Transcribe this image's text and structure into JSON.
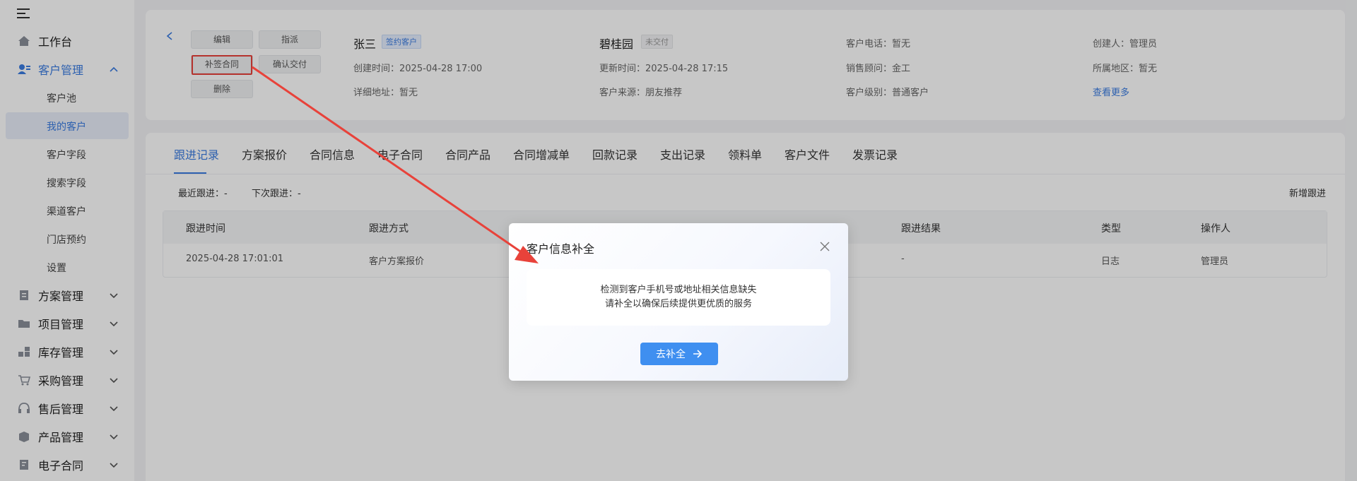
{
  "sidebar": {
    "workbench": "工作台",
    "customer_mgmt": "客户管理",
    "sub": [
      "客户池",
      "我的客户",
      "客户字段",
      "搜索字段",
      "渠道客户",
      "门店预约",
      "设置"
    ],
    "groups": [
      "方案管理",
      "项目管理",
      "库存管理",
      "采购管理",
      "售后管理",
      "产品管理",
      "电子合同"
    ]
  },
  "actions": {
    "edit": "编辑",
    "assign": "指派",
    "supplement_contract": "补签合同",
    "confirm_delivery": "确认交付",
    "delete": "删除"
  },
  "customer": {
    "name": "张三",
    "name_tag": "签约客户",
    "create_time": "创建时间：2025-04-28 17:00",
    "address": "详细地址：暂无",
    "community": "碧桂园",
    "community_tag": "未交付",
    "update_time": "更新时间：2025-04-28 17:15",
    "source": "客户来源：朋友推荐",
    "phone": "客户电话：暂无",
    "sales": "销售顾问：金工",
    "level": "客户级别：普通客户",
    "creator": "创建人：管理员",
    "region": "所属地区：暂无",
    "more": "查看更多"
  },
  "tabs": [
    "跟进记录",
    "方案报价",
    "合同信息",
    "电子合同",
    "合同产品",
    "合同增减单",
    "回款记录",
    "支出记录",
    "领料单",
    "客户文件",
    "发票记录"
  ],
  "followup": {
    "recent": "最近跟进：-",
    "next": "下次跟进：-",
    "add": "新增跟进",
    "headers": [
      "跟进时间",
      "跟进方式",
      "跟进结果",
      "类型",
      "操作人"
    ],
    "row": [
      "2025-04-28 17:01:01",
      "客户方案报价",
      "-",
      "日志",
      "管理员"
    ]
  },
  "modal": {
    "title": "客户信息补全",
    "line1": "检测到客户手机号或地址相关信息缺失",
    "line2": "请补全以确保后续提供更优质的服务",
    "button": "去补全"
  },
  "colors": {
    "accent": "#3a7be0",
    "annotation": "#e8423a",
    "button": "#3f8ff0"
  }
}
